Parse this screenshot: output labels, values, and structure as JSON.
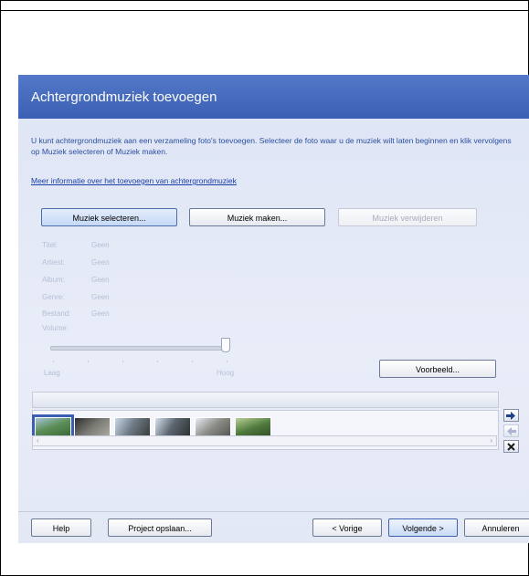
{
  "dialog": {
    "title": "Achtergrondmuziek toevoegen",
    "description": "U kunt achtergrondmuziek aan een verzameling foto's toevoegen. Selecteer de foto waar u de muziek wilt laten beginnen en klik vervolgens op Muziek selecteren of Muziek maken.",
    "link": "Meer informatie over het toevoegen van achtergrondmuziek"
  },
  "music_buttons": {
    "select": "Muziek selecteren...",
    "create": "Muziek maken...",
    "remove": "Muziek verwijderen"
  },
  "fields": [
    {
      "label": "Titel:",
      "value": "Geen"
    },
    {
      "label": "Artiest:",
      "value": "Geen"
    },
    {
      "label": "Album:",
      "value": "Geen"
    },
    {
      "label": "Genre:",
      "value": "Geen"
    },
    {
      "label": "Bestand:",
      "value": "Geen"
    }
  ],
  "volume": {
    "label": "Volume:",
    "low": "Laag",
    "high": "Hoog",
    "level": 1.0
  },
  "preview_button": "Voorbeeld...",
  "side_controls": {
    "next_icon": "arrow-right-icon",
    "prev_icon": "arrow-left-icon",
    "remove_icon": "close-x-icon"
  },
  "scroll": {
    "left": "‹",
    "right": "›"
  },
  "footer": {
    "help": "Help",
    "save_project": "Project opslaan...",
    "previous": "< Vorige",
    "next": "Volgende >",
    "cancel": "Annuleren"
  },
  "colors": {
    "titlebar": "#3b5fb3",
    "dialog_bg": "#e6eaf6",
    "accent_text": "#2a4fa0"
  }
}
